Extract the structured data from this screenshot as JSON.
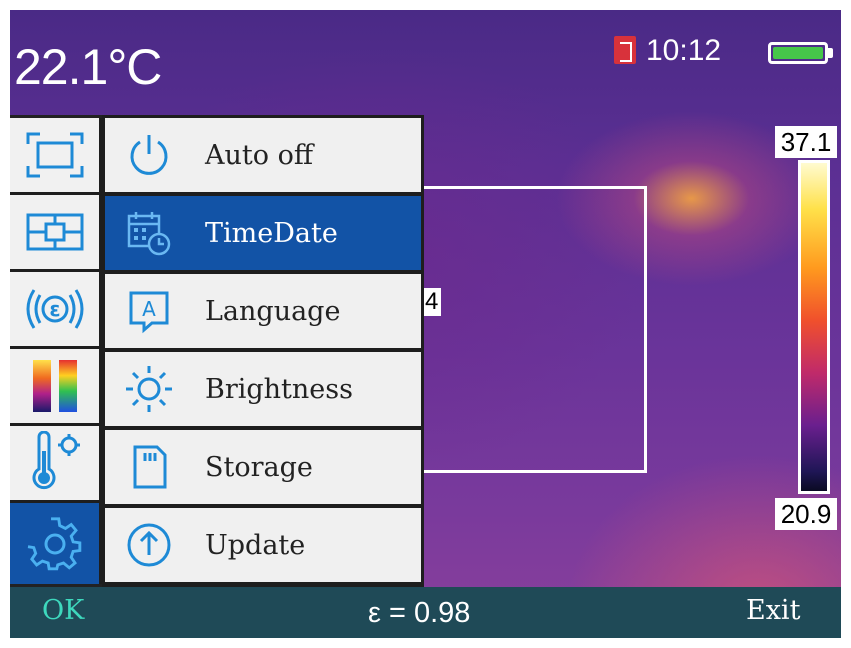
{
  "status": {
    "temperature": "22.1°C",
    "time": "10:12"
  },
  "spot_value": "4",
  "scale": {
    "max": "37.1",
    "min": "20.9"
  },
  "sidebar": {
    "items": [
      {
        "icon": "area-measure-icon",
        "active": false
      },
      {
        "icon": "center-spot-icon",
        "active": false
      },
      {
        "icon": "emissivity-icon",
        "active": false
      },
      {
        "icon": "palette-icon",
        "active": false
      },
      {
        "icon": "temperature-settings-icon",
        "active": false
      },
      {
        "icon": "settings-gear-icon",
        "active": true
      }
    ]
  },
  "menu": {
    "items": [
      {
        "label": "Auto off",
        "icon": "power-icon",
        "active": false
      },
      {
        "label": "TimeDate",
        "icon": "calendar-clock-icon",
        "active": true
      },
      {
        "label": "Language",
        "icon": "language-icon",
        "active": false
      },
      {
        "label": "Brightness",
        "icon": "brightness-icon",
        "active": false
      },
      {
        "label": "Storage",
        "icon": "sd-card-icon",
        "active": false
      },
      {
        "label": "Update",
        "icon": "update-arrow-icon",
        "active": false
      }
    ]
  },
  "bottom": {
    "ok": "OK",
    "emissivity": "ε = 0.98",
    "exit": "Exit"
  },
  "colors": {
    "accent": "#1253a6",
    "bottom_bar": "#1f4a57",
    "ok_text": "#3ed8bd"
  }
}
